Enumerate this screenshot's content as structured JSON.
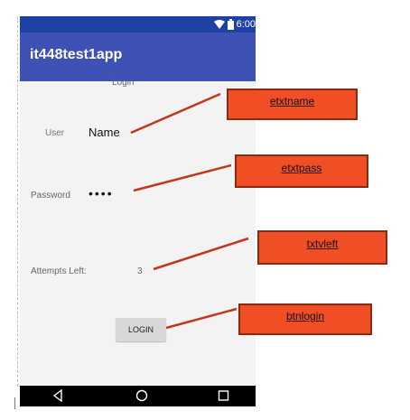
{
  "status_bar": {
    "time": "6:00"
  },
  "app_bar": {
    "title": "it448test1app"
  },
  "form": {
    "header_label": "Login",
    "user_label": "User",
    "user_value": "Name",
    "password_label": "Password",
    "password_value": "••••",
    "attempts_label": "Attempts Left:",
    "attempts_value": "3",
    "login_button_label": "LOGIN"
  },
  "annotations": {
    "etxtname": "etxtname",
    "etxtpass": "etxtpass",
    "txtvleft": "txtvleft",
    "btnlogin": "btnlogin"
  },
  "icons": {
    "wifi": "wifi-icon",
    "battery": "battery-icon",
    "back": "back-triangle-icon",
    "home": "home-circle-icon",
    "recents": "recents-square-icon"
  },
  "colors": {
    "status_bar": "#1e41a6",
    "app_bar": "#3e51b5",
    "annotation_fill": "#f04e24",
    "annotation_border": "#8b2a12",
    "connector_line": "#c2361b",
    "button_bg": "#d8d8d8"
  }
}
